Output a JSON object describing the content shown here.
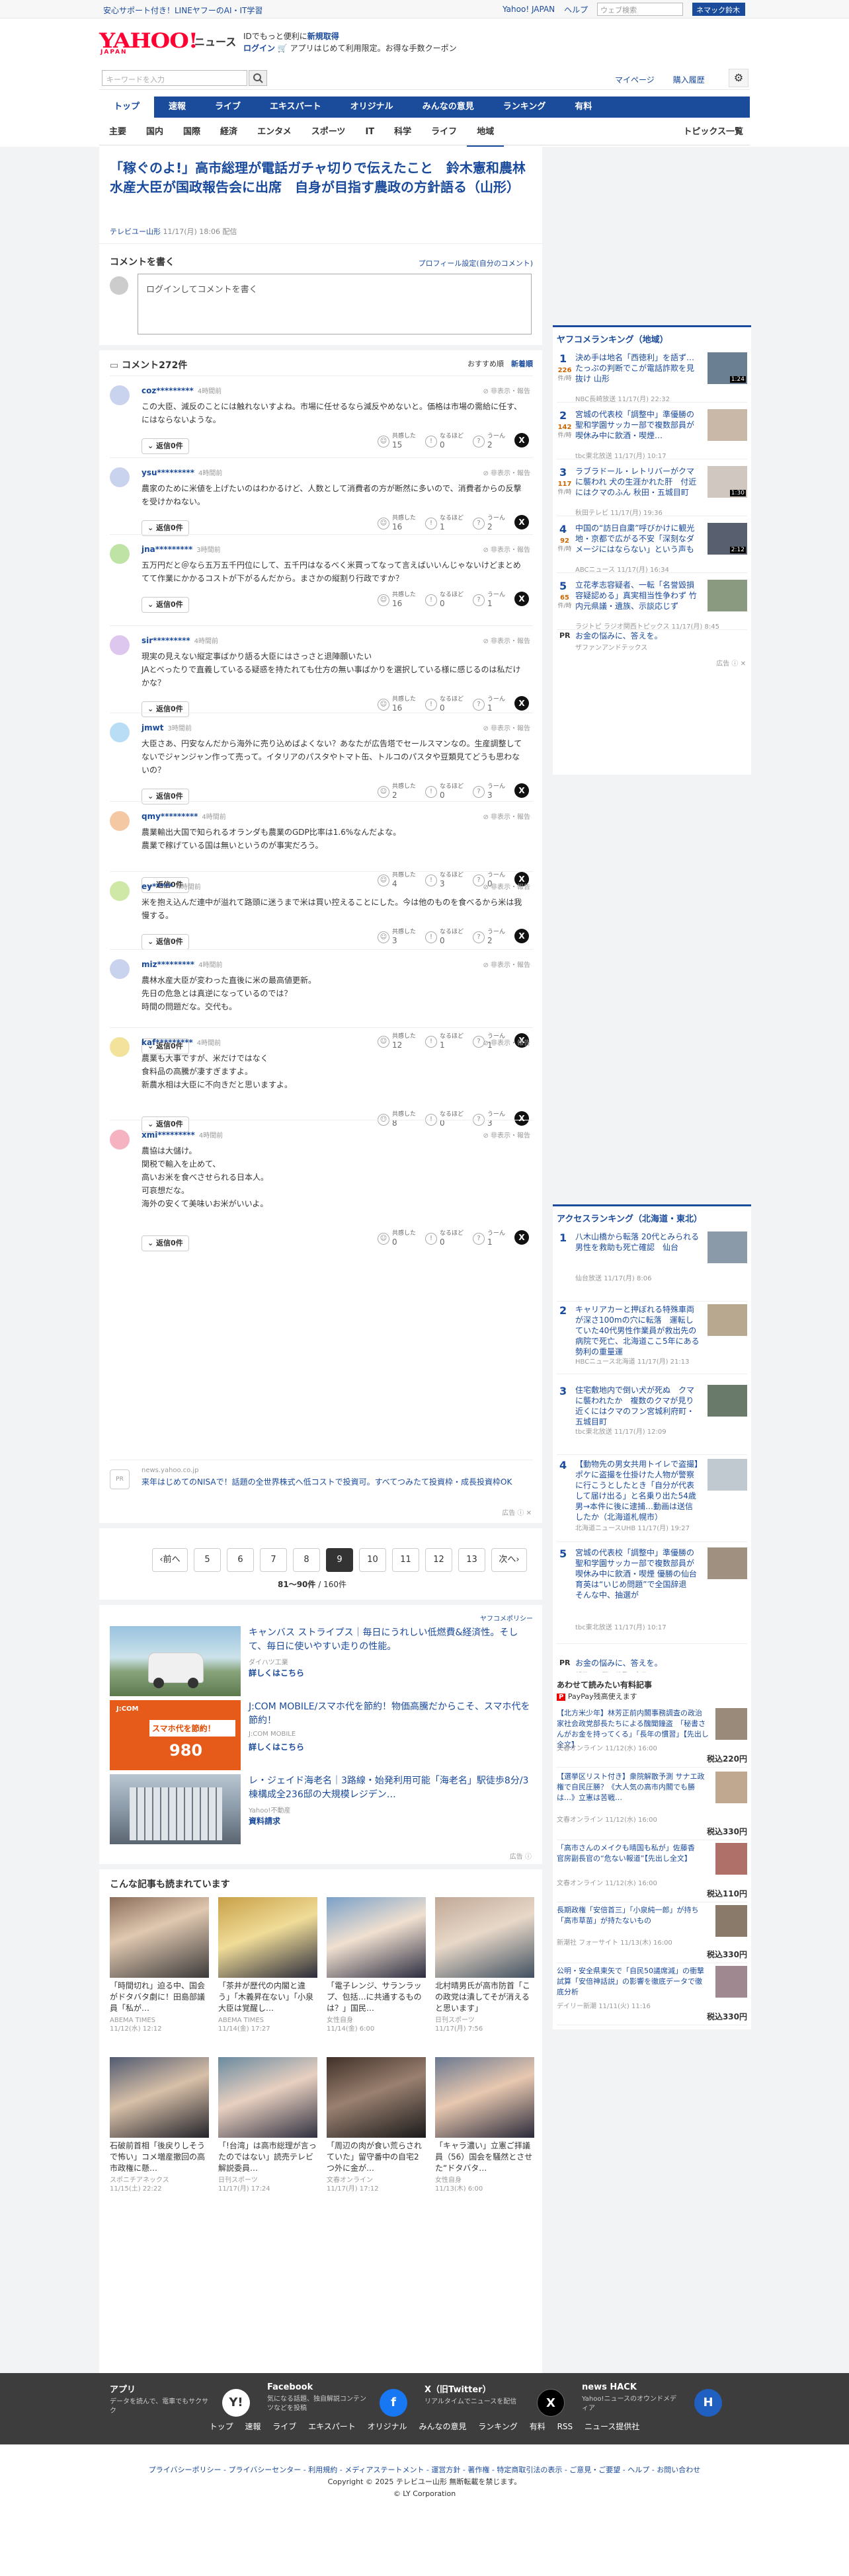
{
  "topbar": {
    "left_link": "安心サポート付き！LINEヤフーのAI・IT学習",
    "right_links": [
      "Yahoo! JAPAN",
      "ヘルプ"
    ],
    "search_placeholder": "ウェブ検索",
    "search_button": "ネマック鈴木"
  },
  "header": {
    "logo": "YAHOO!",
    "logo_sub": "JAPAN",
    "news": "ニュース",
    "msg1": "IDでもっと便利に",
    "msg1_link": "新規取得",
    "msg2_login": "ログイン",
    "msg2": "アプリはじめて利用限定。お得な手数クーポン"
  },
  "search": {
    "placeholder": "キーワードを入力",
    "links": [
      "マイページ",
      "購入履歴"
    ]
  },
  "gnav": [
    "トップ",
    "速報",
    "ライブ",
    "エキスパート",
    "オリジナル",
    "みんなの意見",
    "ランキング",
    "有料"
  ],
  "subnav": [
    "主要",
    "国内",
    "国際",
    "経済",
    "エンタメ",
    "スポーツ",
    "IT",
    "科学",
    "ライフ",
    "地域"
  ],
  "subnav_right": "トピックス一覧",
  "article": {
    "title": "「稼ぐのよ!」高市総理が電話ガチャ切りで伝えたこと　鈴木憲和農林水産大臣が国政報告会に出席　自身が目指す農政の方針語る（山形）",
    "source": "テレビユー山形",
    "date": "11/17(月) 18:06 配信"
  },
  "comment_write": {
    "heading": "コメントを書く",
    "profile_link": "プロフィール設定(自分のコメント)",
    "placeholder": "ログインしてコメントを書く"
  },
  "comments_header": {
    "count": "コメント272件",
    "sort_recommend": "おすすめ順",
    "sort_new": "新着順"
  },
  "comment_labels": {
    "hide": "非表示・報告",
    "reply": "返信",
    "agree": "共感した",
    "naruhodo": "なるほど",
    "uun": "うーん"
  },
  "comments": [
    {
      "user": "coz*********",
      "time": "4時間前",
      "body": "この大臣、減反のことには触れないすよね。市場に任せるなら減反やめないと。価格は市場の需給に任す、にはならないような。",
      "replies": "返信0件",
      "agree": "15",
      "naruhodo": "0",
      "uun": "2",
      "color": "#c9d3ee"
    },
    {
      "user": "ysu*********",
      "time": "4時間前",
      "body": "農家のために米値を上げたいのはわかるけど、人数として消費者の方が断然に多いので、消費者からの反撃を受けかねない。",
      "replies": "返信0件",
      "agree": "16",
      "naruhodo": "1",
      "uun": "2",
      "color": "#c9d3ee"
    },
    {
      "user": "jna*********",
      "time": "3時間前",
      "body": "五万円だと＠なら五万五千円位にして、五千円はなるべく米買ってなって言えばいいんじゃないけどまとめてて作業にかかるコストが下がるんだから。まさかの縦割り行政ですか？",
      "replies": "返信0件",
      "agree": "16",
      "naruhodo": "0",
      "uun": "1",
      "color": "#bfe3a4"
    },
    {
      "user": "sir*********",
      "time": "4時間前",
      "body": "現実の見えない縦定事ばかり語る大臣にはさっさと退陣願いたい\nJAとべったりで直義しているる疑惑を持たれても仕方の無い事ばかりを選択している様に感じるのは私だけかな？",
      "replies": "返信0件",
      "agree": "16",
      "naruhodo": "0",
      "uun": "1",
      "color": "#ddc7ee"
    },
    {
      "user": "jmwt",
      "time": "3時間前",
      "body": "大臣さあ、円安なんだから海外に売り込めばよくない？あなたが広告塔でセールスマンなの。生産調整してないでジャンジャン作って売って。イタリアのパスタやトマト缶、トルコのパスタや豆類見てどうも思わないの？",
      "replies": "返信0件",
      "agree": "2",
      "naruhodo": "0",
      "uun": "3",
      "color": "#b8ddf4"
    },
    {
      "user": "qmy*********",
      "time": "4時間前",
      "body": "農業輸出大国で知られるオランダも農業のGDP比率は1.6%なんだよな。\n農業で稼げている国は無いというのが事実だろう。",
      "replies": "返信0件",
      "agree": "4",
      "naruhodo": "3",
      "uun": "0",
      "color": "#f5c8a4"
    },
    {
      "user": "ey*****",
      "time": "4時間前",
      "body": "米を抱え込んだ連中が溢れて路頭に迷うまで米は買い控えることにした。今は他のものを食べるから米は我慢する。",
      "replies": "返信0件",
      "agree": "3",
      "naruhodo": "0",
      "uun": "2",
      "color": "#cfe8a8"
    },
    {
      "user": "miz*********",
      "time": "4時間前",
      "body": "農林水産大臣が変わった直後に米の最高値更新。\n先日の危急とは真逆になっているのでは？\n時間の問題だな。交代も。",
      "replies": "返信0件",
      "agree": "12",
      "naruhodo": "1",
      "uun": "1",
      "color": "#c9d3ee"
    },
    {
      "user": "kaf*********",
      "time": "4時間前",
      "body": "農業も大事ですが、米だけではなく\n食料品の高騰が凄すぎますよ。\n新農水相は大臣に不向きだと思いますよ。",
      "replies": "返信0件",
      "agree": "8",
      "naruhodo": "0",
      "uun": "3",
      "color": "#f3e29b"
    },
    {
      "user": "xmi*********",
      "time": "4時間前",
      "body": "農協は大儲け。\n関税で輸入を止めて、\n高いお米を食べさせられる日本人。\n可哀想だな。\n海外の安くて美味いお米がいいよ。",
      "replies": "返信0件",
      "agree": "0",
      "naruhodo": "0",
      "uun": "1",
      "color": "#f5b3c2"
    }
  ],
  "inline_ad": {
    "label": "PR",
    "source": "news.yahoo.co.jp",
    "text": "来年はじめてのNISAで！話題の全世界株式へ低コストで投資可。すべてつみたて投資枠・成長投資枠OK",
    "badge": "広告"
  },
  "pager": {
    "prev": "前へ",
    "pages": [
      "5",
      "6",
      "7",
      "8",
      "9",
      "10",
      "11",
      "12",
      "13"
    ],
    "active": "9",
    "next": "次へ",
    "range": "81〜90件",
    "total": "/ 160件"
  },
  "ads": {
    "policy": "ヤフコメポリシー",
    "items": [
      {
        "title": "キャンバス ストライプス｜毎日にうれしい低燃費&経済性。そして、毎日に使いやすい走りの性能。",
        "sponsor": "ダイハツ工業",
        "more": "詳しくはこちら"
      },
      {
        "title": "J:COM MOBILE/スマホ代を節約！物価高騰だからこそ、スマホ代を節約！",
        "sponsor": "J:COM MOBILE",
        "more": "詳しくはこちら"
      },
      {
        "title": "レ・ジェイド海老名｜3路線・始発利用可能「海老名」駅徒歩8分/3棟構成全236邸の大規模レジデン…",
        "sponsor": "Yahoo!不動産",
        "more": "資料請求"
      }
    ],
    "badge": "広告",
    "img2_text1": "J:COM",
    "img2_text2": "スマホ代を節約！",
    "img2_price": "980"
  },
  "related": {
    "heading": "こんな記事も読まれています",
    "items": [
      {
        "title": "「時間切れ」迫る中、国会がドタバタ劇に！田島部議員「私が…",
        "source": "ABEMA TIMES",
        "date": "11/12(水) 12:12"
      },
      {
        "title": "「茶井が歴代の内閣と違う」「木義昇在ない」「小泉大臣は覚醒し…",
        "source": "ABEMA TIMES",
        "date": "11/14(金) 17:27"
      },
      {
        "title": "「電子レンジ、サランラップ、包括…に共通するものは？」国民…",
        "source": "女性自身",
        "date": "11/14(金) 6:00"
      },
      {
        "title": "北村晴男氏が高市防首「この政党は潰してそが消えると思います」",
        "source": "日刊スポーツ",
        "date": "11/17(月) 7:56"
      },
      {
        "title": "石破前首相「後戻りしそうで怖い」コメ増産撤回の高市政権に懸…",
        "source": "スポニチアネックス",
        "date": "11/15(土) 22:22"
      },
      {
        "title": "「!台湾」は高市総理が言ったのではない」読売テレビ解説委員…",
        "source": "日刊スポーツ",
        "date": "11/17(月) 17:24"
      },
      {
        "title": "「周辺の肉が食い荒らされていた」留守番中の自宅2つ外に金が…",
        "source": "文春オンライン",
        "date": "11/17(月) 17:12"
      },
      {
        "title": "「キャラ濃い」立憲ご拝議員（56）国会を騒然とさせた“ドタバタ…",
        "source": "女性自身",
        "date": "11/13(木) 6:00"
      }
    ]
  },
  "ranking": {
    "heading": "ヤフコメランキング（地域）",
    "count_label": "件/時",
    "items": [
      {
        "no": "1",
        "count": "226",
        "title": "決め手は地名「西徳利」を語ず…たっぷの判断でこが電話詐欺を見抜け 山形",
        "source": "NBC長崎放送",
        "date": "11/17(月) 22:32",
        "dur": "1:24"
      },
      {
        "no": "2",
        "count": "142",
        "title": "宮城の代表校「調整中」準優勝の聖和学園サッカー部で複数部員が喫休み中に飲酒・喫煙…",
        "source": "tbc東北放送",
        "date": "11/17(月) 10:17",
        "dur": ""
      },
      {
        "no": "3",
        "count": "117",
        "title": "ラブラドール・レトリバーがクマに襲われ 犬の生涯かれた肝　付近にはクマのふん 秋田・五城目町",
        "source": "秋田テレビ",
        "date": "11/17(月) 19:36",
        "dur": "1:30"
      },
      {
        "no": "4",
        "count": "92",
        "title": "中国の“訪日自粛”呼びかけに観光地・京都で広がる不安「深刻なダメージにはならない」という声も",
        "source": "ABCニュース",
        "date": "11/17(月) 16:34",
        "dur": "2:12"
      },
      {
        "no": "5",
        "count": "65",
        "title": "立花孝志容疑者、一転「名誉毀損容疑認める」真実相当性争わず 竹内元県議・遺族、示談応じず",
        "source": "ラジトピ ラジオ関西トピックス",
        "date": "11/17(月) 8:45",
        "dur": ""
      }
    ],
    "pr_label": "PR",
    "pr_title": "お金の悩みに、答えを。",
    "pr_source": "ザファンアンドテックス"
  },
  "access": {
    "heading": "アクセスランキング（北海道・東北）",
    "items": [
      {
        "no": "1",
        "title": "八木山橋から転落 20代とみられる男性を救助も死亡確認　仙台",
        "source": "仙台放送",
        "date": "11/17(月) 8:06"
      },
      {
        "no": "2",
        "title": "キャリアカーと押ぼれる特殊車両が深さ100mの穴に転落　運転していた40代男性作業員が救出先の病院で死亡、北海道ここ5年にある勢利の重量運",
        "source": "HBCニュース北海道",
        "date": "11/17(月) 21:13"
      },
      {
        "no": "3",
        "title": "住宅敷地内で倒い犬が死ぬ　クマに襲われたか　複数のクマが見り近くにはクマのフン宮城利府町・五城目町",
        "source": "tbc東北放送",
        "date": "11/17(月) 12:09"
      },
      {
        "no": "4",
        "title": "【動物先の男女共用トイレで盗撮】ポケに盗撮を仕掛けた人物が警察に行こうとしたとき「自分が代表して届け出る」と名乗り出た54歳男→本件に後に逮捕…動画は送信したか（北海道札幌市）",
        "source": "北海道ニュースUHB",
        "date": "11/17(月) 19:27"
      },
      {
        "no": "5",
        "title": "宮城の代表校「調整中」準優勝の聖和学園サッカー部で複数部員が喫休み中に飲酒・喫煙 優勝の仙台育英は“いじめ問題”で全国辞退　そんな中、抽選が",
        "source": "tbc東北放送",
        "date": "11/17(月) 10:17"
      }
    ],
    "pr_label": "PR",
    "pr_title": "お金の悩みに、答えを。",
    "pr_source": "ザファンアンドテックス"
  },
  "paid": {
    "heading": "あわせて読みたい有料記事",
    "payp": "PayPay残高使えます",
    "items": [
      {
        "title": "【北方米少年】林芳正前内閣事務調査の政治家社会政党部長たちによる醜聞鐘盗　「秘書さんがお金を持ってくる」「長年の慣習」【先出し全文】",
        "source": "文春オンライン",
        "date": "11/12(水) 16:00",
        "price": "税込220円"
      },
      {
        "title": "【選挙区リスト付き】衆院解散予測 サナエ政権で自民圧勝？《大人気の高市内閣でも勝は…》立憲は苦戦…",
        "source": "文春オンライン",
        "date": "11/12(水) 16:00",
        "price": "税込330円"
      },
      {
        "title": "「高市さんのメイクも晴国も私が」佐藤香　官房副長官の“危ない報道”【先出し全文】",
        "source": "文春オンライン",
        "date": "11/12(水) 16:00",
        "price": "税込110円"
      },
      {
        "title": "長期政権「安倍首三」「小泉純一郎」が持ち「高市草苗」が持たないもの",
        "source": "新潮社 フォーサイト",
        "date": "11/13(木) 16:00",
        "price": "税込330円"
      },
      {
        "title": "公明・安全県東矢で「自民50議席減」の衝撃試算「安倍神話説」の影響を徹底データで徹底分析",
        "source": "デイリー新潮",
        "date": "11/11(火) 11:16",
        "price": "税込330円"
      }
    ]
  },
  "footer_apps": [
    {
      "name": "アプリ",
      "desc": "データを読んで、電車でもサクサク",
      "icon": "Y!"
    },
    {
      "name": "Facebook",
      "desc": "気になる話題、独自解説コンテンツなどを投稿",
      "icon": "f"
    },
    {
      "name": "X（旧Twitter）",
      "desc": "リアルタイムでニュースを配信",
      "icon": "X"
    },
    {
      "name": "news HACK",
      "desc": "Yahoo!ニュースのオウンドメディア",
      "icon": "H"
    }
  ],
  "footer_nav": [
    "トップ",
    "速報",
    "ライブ",
    "エキスパート",
    "オリジナル",
    "みんなの意見",
    "ランキング",
    "有料",
    "RSS",
    "ニュース提供社"
  ],
  "footer": {
    "links": "プライバシーポリシー - プライバシーセンター - 利用規約 - メディアステートメント - 運営方針 - 著作権 - 特定商取引法の表示 - ご意見・ご要望 - ヘルプ - お問い合わせ",
    "copyright": "Copyright © 2025 テレビユー山形 無断転載を禁じます。",
    "corp": "© LY Corporation"
  },
  "colors": {
    "brand_red": "#ff0033",
    "nav_blue": "#1b4c9b",
    "link_blue": "#1a4a9b",
    "rank_count": "#cc6600"
  }
}
